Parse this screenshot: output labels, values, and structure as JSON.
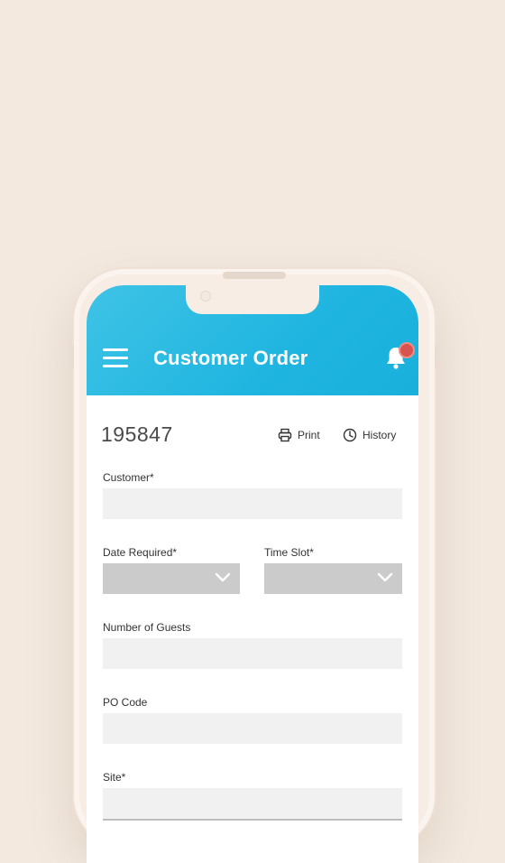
{
  "header": {
    "title": "Customer Order",
    "accent_color": "#1fb5e0",
    "notification_badge_color": "#d9534f"
  },
  "order": {
    "number": "195847"
  },
  "actions": {
    "print_label": "Print",
    "history_label": "History"
  },
  "form": {
    "customer": {
      "label": "Customer*",
      "value": ""
    },
    "date_required": {
      "label": "Date Required*",
      "value": ""
    },
    "time_slot": {
      "label": "Time Slot*",
      "value": ""
    },
    "number_of_guests": {
      "label": "Number of Guests",
      "value": ""
    },
    "po_code": {
      "label": "PO Code",
      "value": ""
    },
    "site": {
      "label": "Site*",
      "value": ""
    }
  },
  "icons": {
    "menu": "hamburger-menu-icon",
    "notifications": "bell-icon",
    "print": "printer-icon",
    "history": "clock-icon",
    "dropdown": "chevron-down-icon"
  }
}
